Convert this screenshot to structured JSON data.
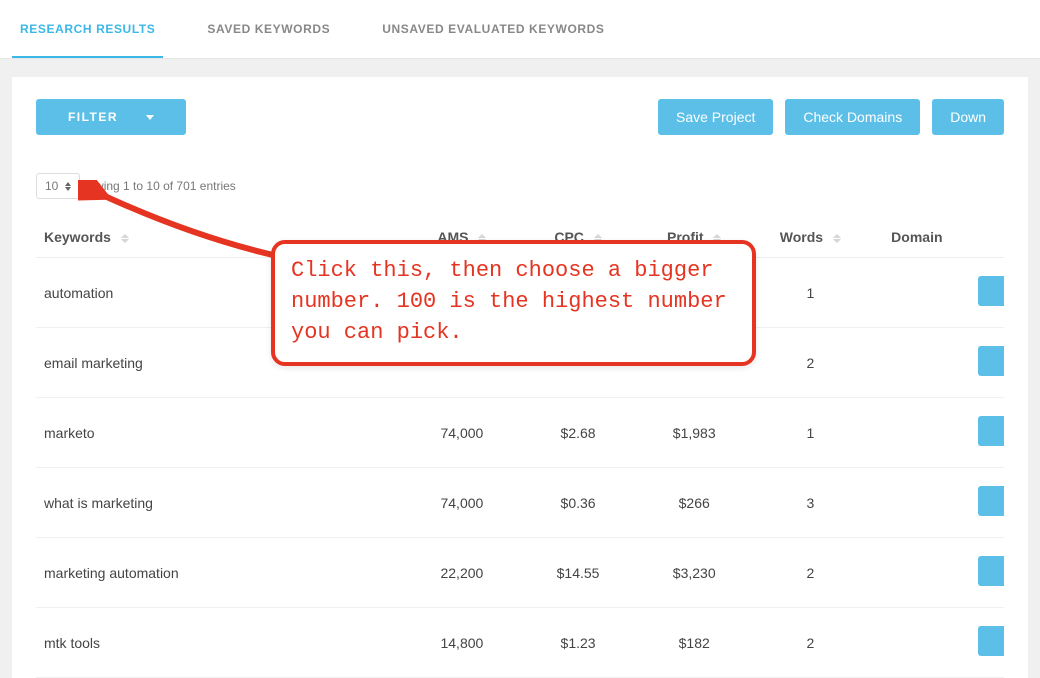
{
  "tabs": {
    "research": "RESEARCH RESULTS",
    "saved": "SAVED KEYWORDS",
    "unsaved": "UNSAVED EVALUATED KEYWORDS"
  },
  "toolbar": {
    "filter": "FILTER",
    "save_project": "Save Project",
    "check_domains": "Check Domains",
    "download": "Down"
  },
  "pager": {
    "page_size": "10",
    "showing": "owing 1 to 10 of 701 entries"
  },
  "columns": {
    "keywords": "Keywords",
    "ams": "AMS",
    "cpc": "CPC",
    "profit": "Profit",
    "words": "Words",
    "domain": "Domain"
  },
  "rows": [
    {
      "keyword": "automation",
      "ams": "",
      "cpc": "",
      "profit": "",
      "words": "1"
    },
    {
      "keyword": "email marketing",
      "ams": "",
      "cpc": "",
      "profit": "",
      "words": "2"
    },
    {
      "keyword": "marketo",
      "ams": "74,000",
      "cpc": "$2.68",
      "profit": "$1,983",
      "words": "1"
    },
    {
      "keyword": "what is marketing",
      "ams": "74,000",
      "cpc": "$0.36",
      "profit": "$266",
      "words": "3"
    },
    {
      "keyword": "marketing automation",
      "ams": "22,200",
      "cpc": "$14.55",
      "profit": "$3,230",
      "words": "2"
    },
    {
      "keyword": "mtk tools",
      "ams": "14,800",
      "cpc": "$1.23",
      "profit": "$182",
      "words": "2"
    }
  ],
  "annotation": {
    "text": "Click this, then choose a bigger number. 100 is the highest number you can pick."
  }
}
